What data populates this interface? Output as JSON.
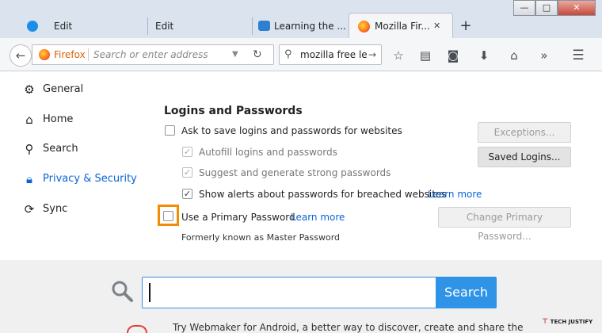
{
  "tabs": [
    {
      "label": "Edit"
    },
    {
      "label": "Edit"
    },
    {
      "label": "Learning the ..."
    },
    {
      "label": "Mozilla Fir..."
    }
  ],
  "window": {
    "minimize": "—",
    "maximize": "□",
    "close": "✕"
  },
  "navbar": {
    "identity_label": "Firefox",
    "address_placeholder": "Search or enter address",
    "search_value": "mozilla free lea"
  },
  "sidebar": {
    "items": [
      {
        "label": "General",
        "icon": "gear-icon"
      },
      {
        "label": "Home",
        "icon": "home-icon"
      },
      {
        "label": "Search",
        "icon": "search-icon"
      },
      {
        "label": "Privacy & Security",
        "icon": "lock-icon",
        "active": true
      },
      {
        "label": "Sync",
        "icon": "sync-icon"
      }
    ]
  },
  "logins": {
    "heading": "Logins and Passwords",
    "ask_to_save": "Ask to save logins and passwords for websites",
    "autofill": "Autofill logins and passwords",
    "suggest": "Suggest and generate strong passwords",
    "alerts": "Show alerts about passwords for breached websites",
    "alerts_learn_more": "Learn more",
    "primary_password": "Use a Primary Password",
    "primary_learn_more": "Learn more",
    "formerly": "Formerly known as Master Password",
    "exceptions_button": "Exceptions...",
    "saved_logins_button": "Saved Logins...",
    "change_primary_button": "Change Primary Password..."
  },
  "web_search": {
    "button_label": "Search",
    "value": "",
    "promo_text": "Try Webmaker for Android, a better way to discover, create and share the"
  },
  "watermark": {
    "text": "TECH JUSTIFY"
  },
  "colors": {
    "accent": "#0a64d6",
    "highlight": "#f28c00",
    "search_button": "#2f93e8"
  }
}
